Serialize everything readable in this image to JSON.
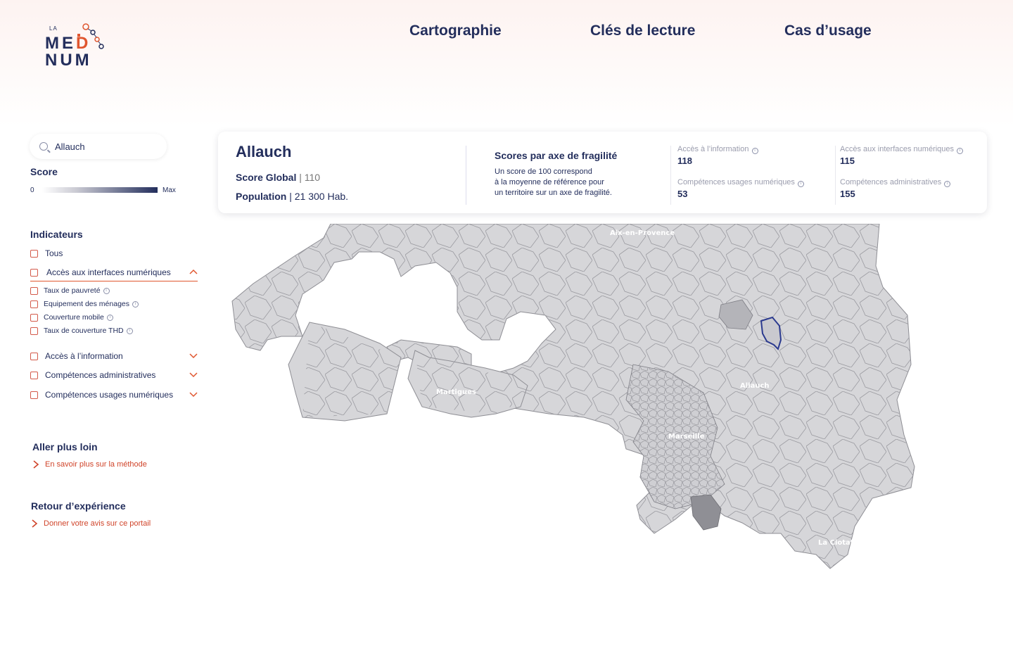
{
  "logo": {
    "la": "LA",
    "line1_a": "ME",
    "line1_b": "D",
    "line2": "NUM"
  },
  "nav": [
    "Cartographie",
    "Clés de lecture",
    "Cas d’usage"
  ],
  "search": {
    "value": "Allauch"
  },
  "score": {
    "title": "Score",
    "min": "0",
    "max": "Max"
  },
  "indicators": {
    "title": "Indicateurs",
    "all": "Tous",
    "groups": [
      {
        "label": "Accès aux interfaces numériques",
        "expanded": true,
        "items": [
          "Taux de pauvreté",
          "Equipement des ménages",
          "Couverture mobile",
          "Taux de couverture THD"
        ]
      },
      {
        "label": "Accès à l’information",
        "expanded": false
      },
      {
        "label": "Compétences administratives",
        "expanded": false
      },
      {
        "label": "Compétences usages numériques",
        "expanded": false
      }
    ]
  },
  "more": {
    "title": "Aller plus loin",
    "link": "En savoir plus sur la méthode"
  },
  "feedback": {
    "title": "Retour d’expérience",
    "link": "Donner votre avis sur ce portail"
  },
  "card": {
    "name": "Allauch",
    "score_label": "Score Global",
    "score_value": "| 110",
    "population_label": "Population",
    "population_value": "| 21 300 Hab.",
    "axes_title": "Scores par axe de fragilité",
    "axes_desc_1": "Un score de 100 correspond",
    "axes_desc_2": "à la moyenne de référence pour",
    "axes_desc_3": "un territoire sur un axe de fragilité.",
    "metrics": [
      {
        "label": "Accès à l’information",
        "value": "118"
      },
      {
        "label": "Accès aux interfaces numériques",
        "value": "115"
      },
      {
        "label": "Compétences usages numériques",
        "value": "53"
      },
      {
        "label": "Compétences administratives",
        "value": "155"
      }
    ]
  },
  "map": {
    "cities": [
      "Aix-en-Provence",
      "Martigues",
      "Allauch",
      "Marseille",
      "La Ciotat"
    ],
    "colors": {
      "fill": "#d6d6d9",
      "stroke": "#8e8e94",
      "selected": "#2b3a8f",
      "dark": "#8f8f95"
    }
  }
}
